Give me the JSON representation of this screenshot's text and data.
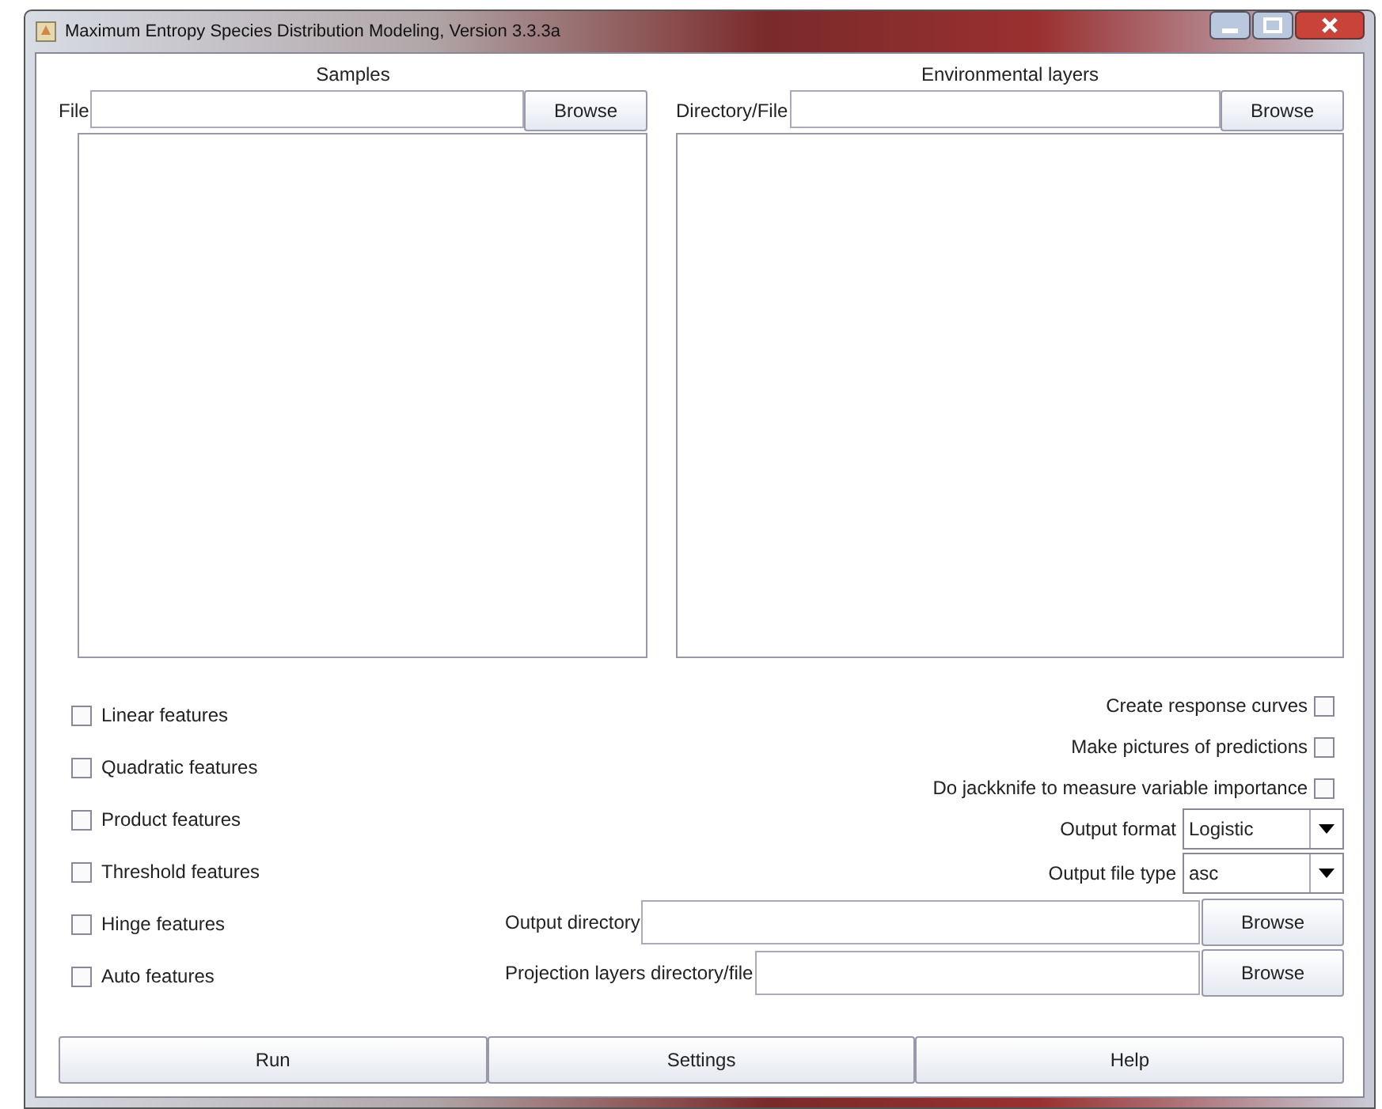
{
  "window": {
    "title": "Maximum Entropy Species Distribution Modeling, Version 3.3.3a"
  },
  "samples": {
    "title": "Samples",
    "field_label": "File",
    "browse": "Browse"
  },
  "environmental_layers": {
    "title": "Environmental layers",
    "field_label": "Directory/File",
    "browse": "Browse"
  },
  "features": [
    {
      "label": "Linear features",
      "checked": false
    },
    {
      "label": "Quadratic features",
      "checked": false
    },
    {
      "label": "Product features",
      "checked": false
    },
    {
      "label": "Threshold features",
      "checked": false
    },
    {
      "label": "Hinge features",
      "checked": false
    },
    {
      "label": "Auto features",
      "checked": false
    }
  ],
  "options": [
    {
      "kind": "checkbox",
      "label": "Create response curves",
      "checked": false
    },
    {
      "kind": "checkbox",
      "label": "Make pictures of predictions",
      "checked": false
    },
    {
      "kind": "checkbox",
      "label": "Do jackknife to measure variable importance",
      "checked": false
    },
    {
      "kind": "select",
      "label": "Output format",
      "value": "Logistic"
    },
    {
      "kind": "select",
      "label": "Output file type",
      "value": "asc"
    }
  ],
  "paths": [
    {
      "label": "Output directory",
      "browse": "Browse"
    },
    {
      "label": "Projection layers directory/file",
      "browse": "Browse"
    }
  ],
  "buttons": [
    "Run",
    "Settings",
    "Help"
  ]
}
